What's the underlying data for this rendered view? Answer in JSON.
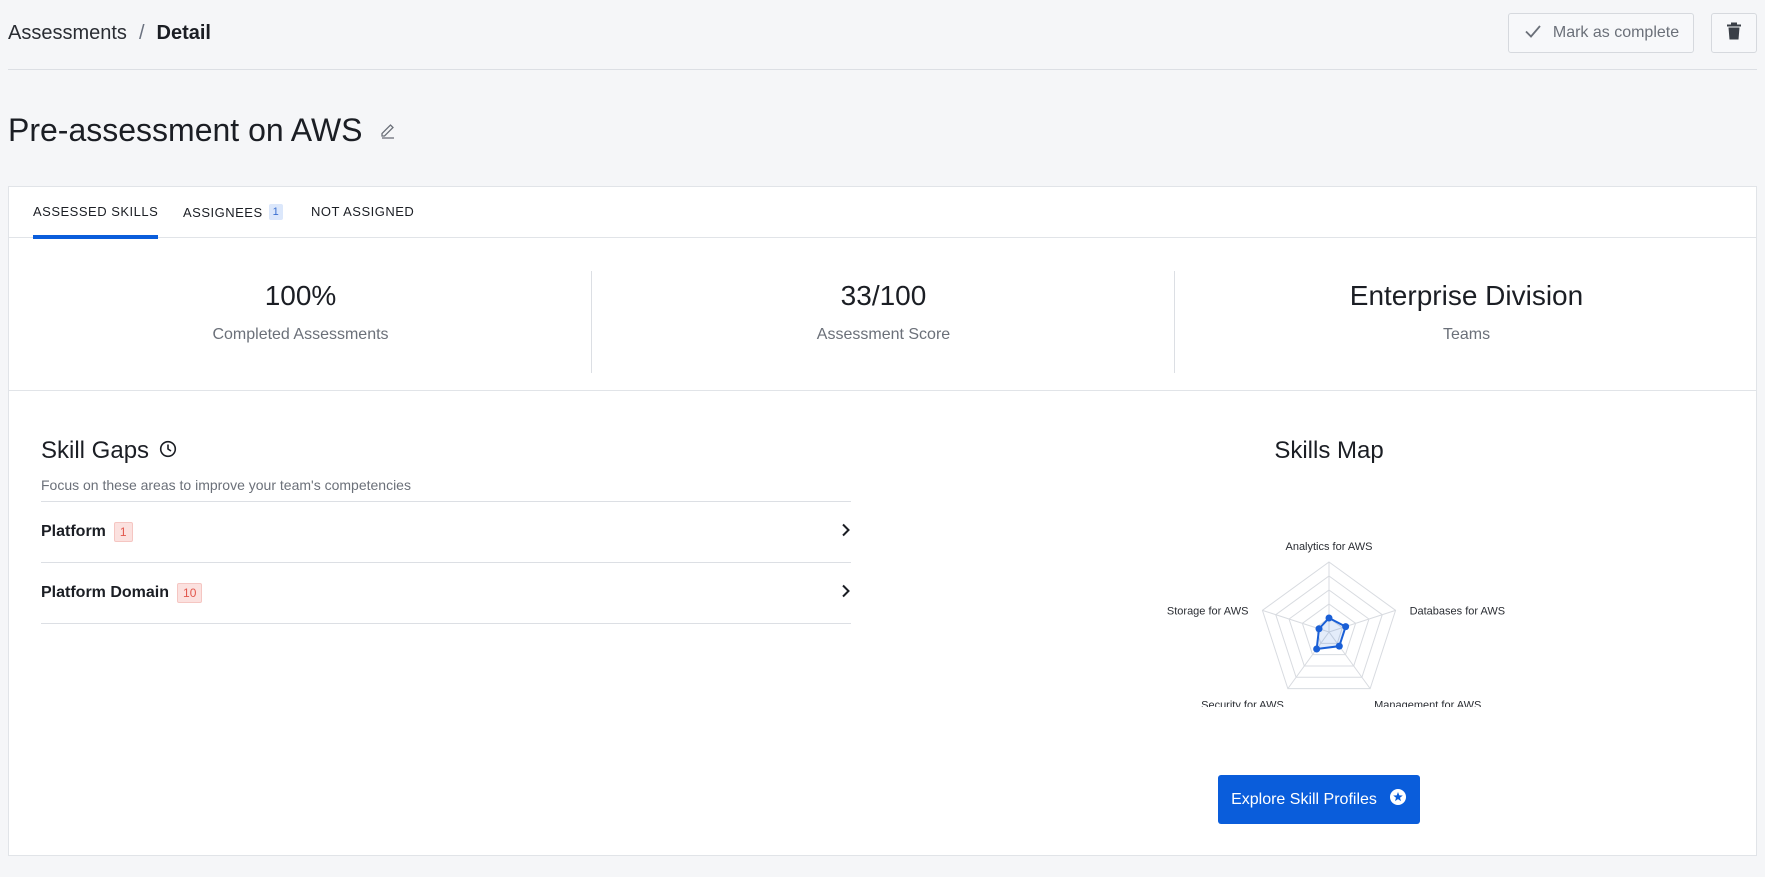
{
  "breadcrumb": {
    "root": "Assessments",
    "separator": "/",
    "current": "Detail"
  },
  "actions": {
    "mark_complete": "Mark as complete"
  },
  "page": {
    "title": "Pre-assessment on AWS"
  },
  "tabs": [
    {
      "label": "ASSESSED SKILLS",
      "active": true
    },
    {
      "label": "ASSIGNEES",
      "count": "1"
    },
    {
      "label": "NOT ASSIGNED"
    }
  ],
  "stats": [
    {
      "value": "100%",
      "label": "Completed Assessments"
    },
    {
      "value": "33/100",
      "label": "Assessment Score"
    },
    {
      "value": "Enterprise Division",
      "label": "Teams"
    }
  ],
  "skill_gaps": {
    "title": "Skill Gaps",
    "subtitle": "Focus on these areas to improve your team's competencies",
    "items": [
      {
        "label": "Platform",
        "count": "1"
      },
      {
        "label": "Platform Domain",
        "count": "10"
      }
    ]
  },
  "skills_map": {
    "title": "Skills Map",
    "axes": [
      "Analytics for AWS",
      "Databases for AWS",
      "Management for AWS",
      "Security for AWS",
      "Storage for AWS"
    ],
    "values": [
      0.2,
      0.25,
      0.25,
      0.3,
      0.15
    ],
    "rings": 5,
    "accent": "#1a5fd6"
  },
  "explore_button": {
    "label": "Explore Skill Profiles"
  },
  "colors": {
    "primary": "#0a5ddb",
    "badge_red": "#e2574c",
    "badge_blue_bg": "#dbe7fb"
  },
  "icons": [
    "check-icon",
    "trash-icon",
    "pencil-icon",
    "clock-icon",
    "chevron-right-icon",
    "star-circle-icon"
  ]
}
